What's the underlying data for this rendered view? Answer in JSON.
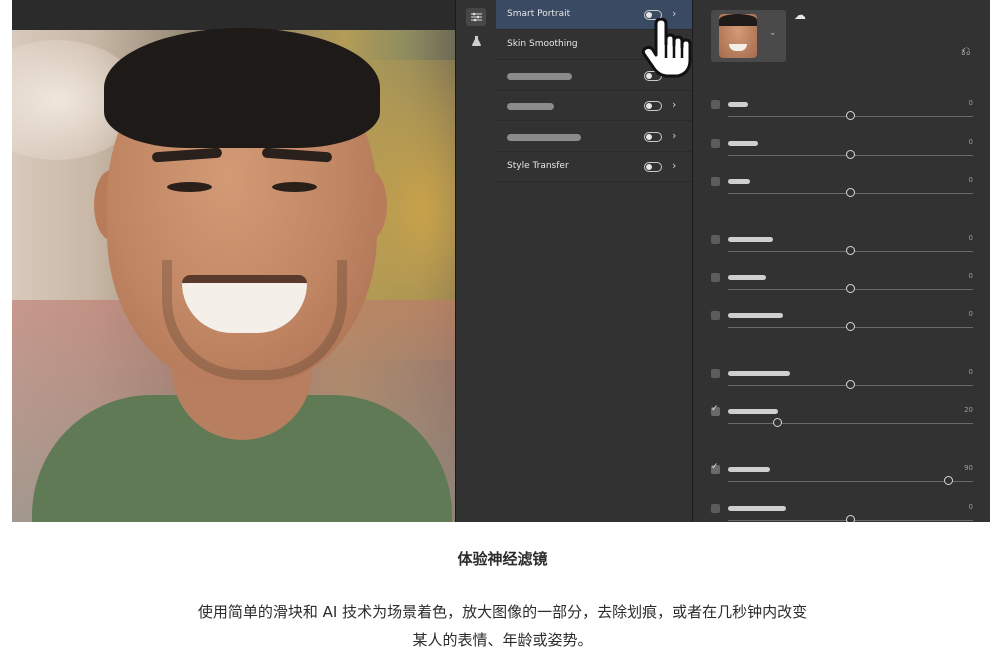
{
  "filter_list": {
    "items": [
      {
        "label": "Smart Portrait",
        "selected": true,
        "toggle_on": false
      },
      {
        "label": "Skin Smoothing",
        "selected": false,
        "toggle_on": false
      },
      {
        "label": "",
        "selected": false,
        "toggle_on": false
      },
      {
        "label": "",
        "selected": false,
        "toggle_on": false
      },
      {
        "label": "",
        "selected": false,
        "toggle_on": false
      },
      {
        "label": "Style Transfer",
        "selected": false,
        "toggle_on": false
      }
    ]
  },
  "settings": {
    "sliders": [
      {
        "checked": false,
        "value": "0",
        "level": 0.5
      },
      {
        "checked": false,
        "value": "0",
        "level": 0.5
      },
      {
        "checked": false,
        "value": "0",
        "level": 0.5
      },
      {
        "checked": false,
        "value": "0",
        "level": 0.5
      },
      {
        "checked": false,
        "value": "0",
        "level": 0.5
      },
      {
        "checked": false,
        "value": "0",
        "level": 0.5
      },
      {
        "checked": false,
        "value": "0",
        "level": 0.5
      },
      {
        "checked": true,
        "value": "20",
        "level": 0.2
      },
      {
        "checked": true,
        "value": "90",
        "level": 0.9
      },
      {
        "checked": false,
        "value": "0",
        "level": 0.5
      }
    ]
  },
  "icons": {
    "toolstrip": [
      "sliders-icon",
      "flask-icon"
    ],
    "cloud": "cloud-icon",
    "reset": "reset-icon",
    "cursor": "hand-pointer-icon"
  },
  "caption": {
    "title": "体验神经滤镜",
    "body_line1": "使用简单的滑块和 AI 技术为场景着色，放大图像的一部分，去除划痕，或者在几秒钟内改变",
    "body_line2": "某人的表情、年龄或姿势。"
  },
  "colors": {
    "panel_bg": "#323232",
    "selected_row": "#3a4a63",
    "caption_text": "#2c2c2c"
  }
}
